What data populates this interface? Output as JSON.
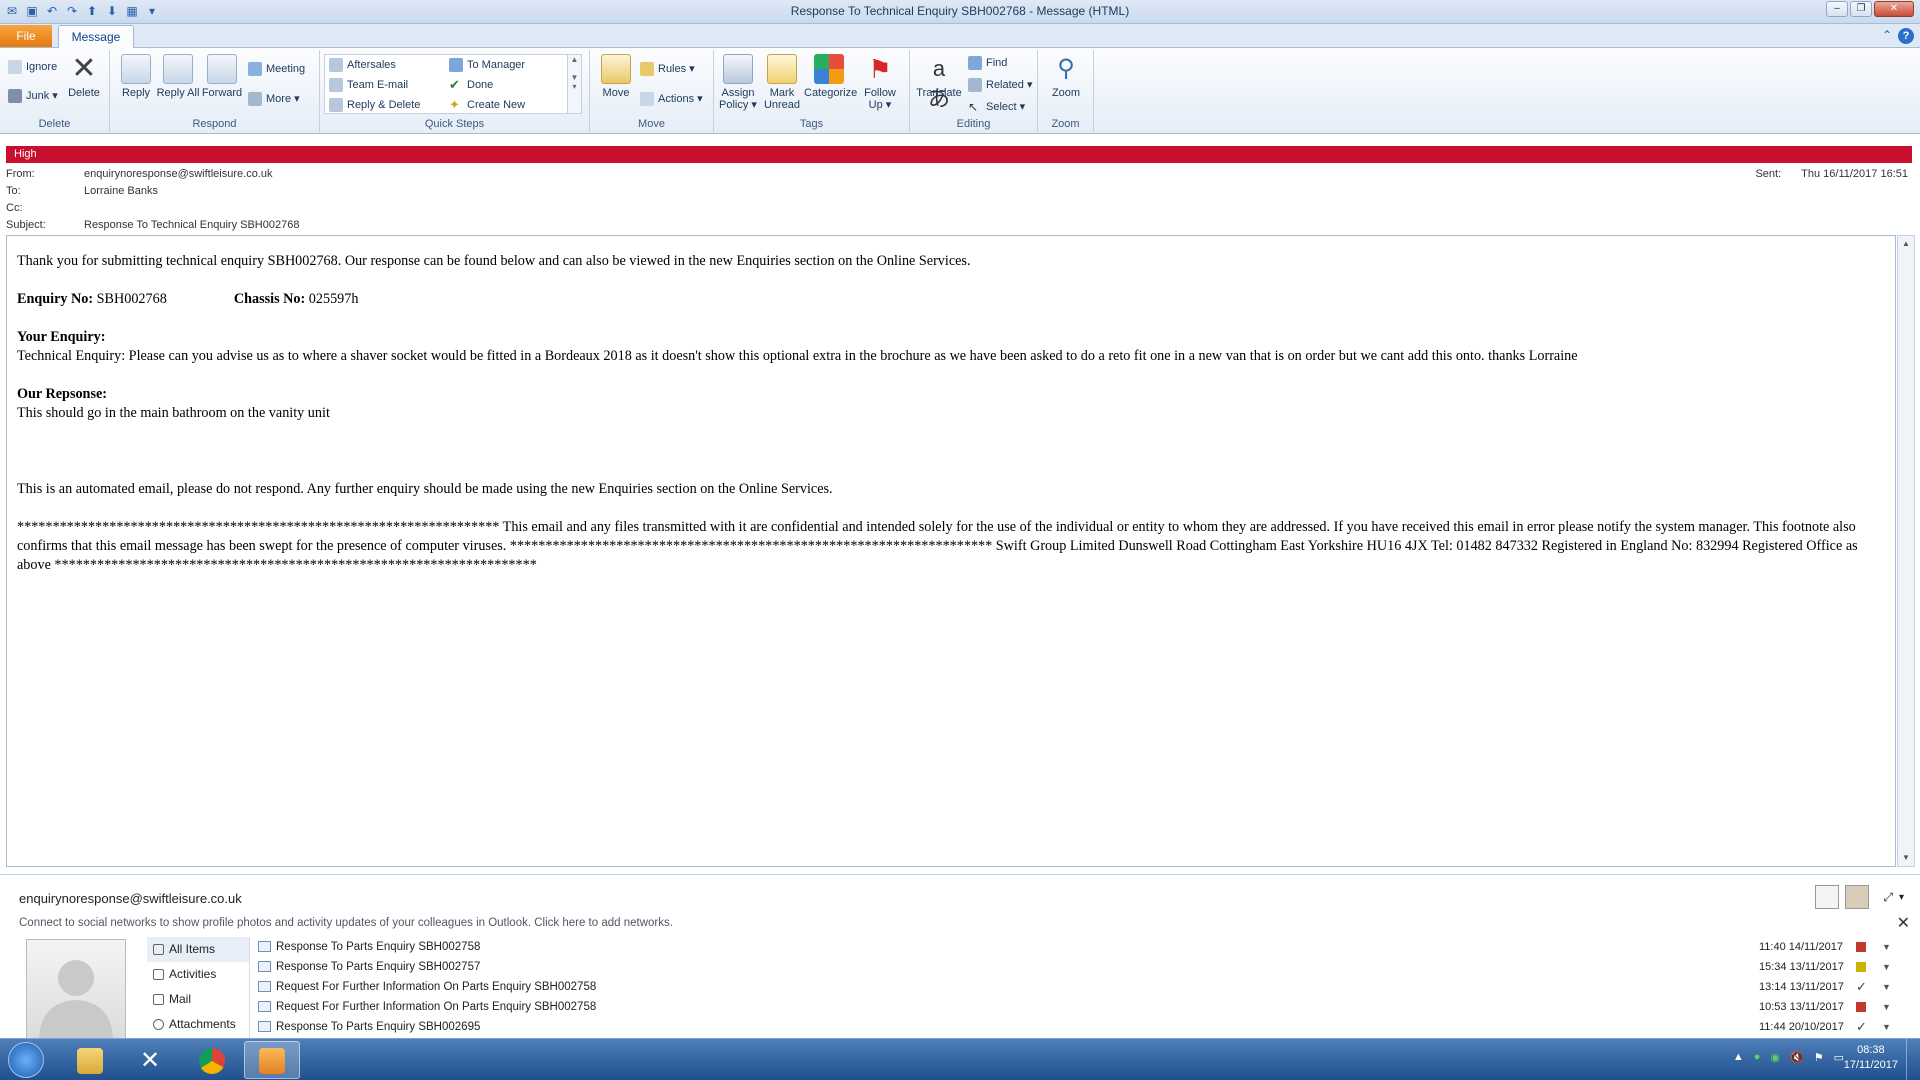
{
  "window": {
    "title": "Response To Technical Enquiry SBH002768  -  Message (HTML)"
  },
  "tabs": {
    "file": "File",
    "message": "Message"
  },
  "ribbon": {
    "delete_group": {
      "label": "Delete",
      "ignore": "Ignore",
      "junk": "Junk ▾",
      "delete": "Delete"
    },
    "respond_group": {
      "label": "Respond",
      "reply": "Reply",
      "reply_all": "Reply All",
      "forward": "Forward",
      "meeting": "Meeting",
      "more": "More ▾"
    },
    "quick_steps_group": {
      "label": "Quick Steps",
      "aftersales": "Aftersales",
      "team_email": "Team E-mail",
      "reply_delete": "Reply & Delete",
      "to_manager": "To Manager",
      "done": "Done",
      "create_new": "Create New"
    },
    "move_group": {
      "label": "Move",
      "move": "Move",
      "rules": "Rules ▾",
      "actions": "Actions ▾"
    },
    "tags_group": {
      "label": "Tags",
      "assign_policy": "Assign Policy ▾",
      "mark_unread": "Mark Unread",
      "categorize": "Categorize",
      "follow_up": "Follow Up ▾"
    },
    "editing_group": {
      "label": "Editing",
      "translate": "Translate",
      "find": "Find",
      "related": "Related ▾",
      "select": "Select ▾"
    },
    "zoom_group": {
      "label": "Zoom",
      "zoom": "Zoom"
    }
  },
  "header": {
    "priority": "High",
    "from_label": "From:",
    "from": "enquirynoresponse@swiftleisure.co.uk",
    "to_label": "To:",
    "to": "Lorraine Banks",
    "cc_label": "Cc:",
    "cc": "",
    "subject_label": "Subject:",
    "subject": "Response To Technical Enquiry SBH002768",
    "sent_label": "Sent:",
    "sent": "Thu 16/11/2017 16:51"
  },
  "body": {
    "intro": "Thank you for submitting technical enquiry SBH002768. Our response can be found below and can also be viewed in the new Enquiries section on the Online Services.",
    "enquiry_no_label": "Enquiry No:",
    "enquiry_no": "SBH002768",
    "chassis_no_label": "Chassis No:",
    "chassis_no": "025597h",
    "your_enquiry_label": "Your Enquiry:",
    "your_enquiry": "Technical Enquiry: Please can you advise us as to where a shaver socket would be fitted in a Bordeaux 2018 as it doesn't show this optional extra in the brochure as we have been asked to do a reto fit one in a new van that is on order but we cant add this onto. thanks Lorraine",
    "our_response_label": "Our Repsonse:",
    "our_response": "This should go in the main bathroom on the vanity unit",
    "automated": "This is an automated email, please do not respond. Any further enquiry should be made using the new Enquiries section on the Online Services.",
    "footer": "******************************************************************** This email and any files transmitted with it are confidential and intended solely for the use of the individual or entity to whom they are addressed. If you have received this email in error please notify the system manager. This footnote also confirms that this email message has been swept for the presence of computer viruses. ******************************************************************** Swift Group Limited Dunswell Road Cottingham East Yorkshire HU16 4JX Tel: 01482 847332 Registered in England No: 832994 Registered Office as above ********************************************************************"
  },
  "people_pane": {
    "name": "enquirynoresponse@swiftleisure.co.uk",
    "social_message": "Connect to social networks to show profile photos and activity updates of your colleagues in Outlook. Click here to add networks.",
    "nav": [
      "All Items",
      "Activities",
      "Mail",
      "Attachments"
    ],
    "items": [
      {
        "subject": "Response To Parts Enquiry SBH002758",
        "date": "11:40  14/11/2017",
        "flag_color": "#c0392b"
      },
      {
        "subject": "Response To Parts Enquiry SBH002757",
        "date": "15:34  13/11/2017",
        "flag_color": "#c9b400"
      },
      {
        "subject": "Request For Further Information On Parts Enquiry SBH002758",
        "date": "13:14  13/11/2017",
        "flag_color": "check"
      },
      {
        "subject": "Request For Further Information On Parts Enquiry SBH002758",
        "date": "10:53  13/11/2017",
        "flag_color": "#c0392b"
      },
      {
        "subject": "Response To Parts Enquiry SBH002695",
        "date": "11:44  20/10/2017",
        "flag_color": "check"
      }
    ]
  },
  "taskbar": {
    "time": "08:38",
    "date": "17/11/2017"
  }
}
